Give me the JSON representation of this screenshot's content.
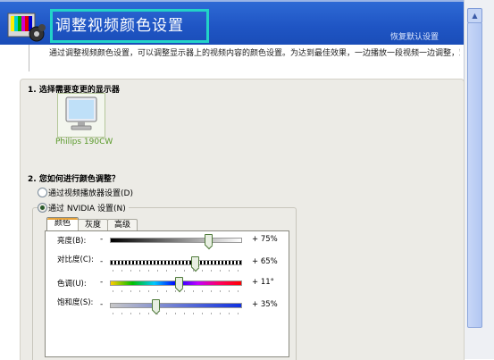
{
  "header": {
    "title": "调整视频颜色设置",
    "restore_link": "恢复默认设置"
  },
  "intro_text": "通过调整视频颜色设置，可以调整显示器上的视频内容的颜色设置。为达到最佳效果，一边播放一段视频一边调整，观察",
  "section1": {
    "title": "1. 选择需要变更的显示器",
    "monitor_name": "Philips 190CW"
  },
  "section2": {
    "title": "2. 您如何进行颜色调整？",
    "option_player": "通过视频播放器设置(D)",
    "option_nvidia": "通过 NVIDIA 设置(N)",
    "selected": "option_nvidia"
  },
  "tabs": [
    "颜色",
    "灰度",
    "高级"
  ],
  "active_tab": "颜色",
  "sliders": [
    {
      "label": "亮度(B):",
      "minus": "-",
      "value_text": "+ 75%",
      "value": 75
    },
    {
      "label": "对比度(C):",
      "minus": "-",
      "value_text": "+ 65%",
      "value": 65
    },
    {
      "label": "色调(U):",
      "minus": "-",
      "value_text": "+ 11°",
      "value": 11
    },
    {
      "label": "饱和度(S):",
      "minus": "-",
      "value_text": "+ 35%",
      "value": 35
    }
  ],
  "colors": {
    "header_blue": "#1f55c4",
    "title_highlight": "#22d3c8",
    "monitor_label_green": "#5a9a2a",
    "tab_accent": "#e7a33a"
  },
  "icons": {
    "app_icon": "monitor-color-bars-icon",
    "monitor": "display-monitor-icon",
    "scroll_up": "scroll-up-arrow-icon"
  }
}
